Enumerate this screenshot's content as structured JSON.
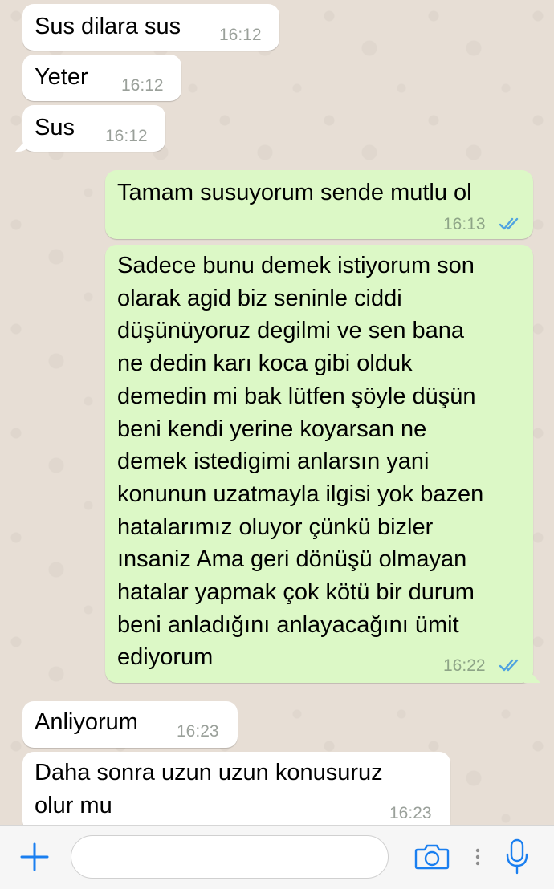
{
  "messages": [
    {
      "direction": "in",
      "lines": [
        "Sus dilara sus"
      ],
      "time": "16:12"
    },
    {
      "direction": "in",
      "lines": [
        "Yeter"
      ],
      "time": "16:12"
    },
    {
      "direction": "in",
      "lines": [
        "Sus"
      ],
      "time": "16:12"
    },
    {
      "direction": "out",
      "lines": [
        "Tamam susuyorum sende mutlu ol"
      ],
      "time": "16:13",
      "read": true
    },
    {
      "direction": "out",
      "lines": [
        "Sadece bunu demek istiyorum son",
        "olarak agid biz seninle ciddi",
        "düşünüyoruz degilmi ve sen bana",
        "ne dedin karı koca gibi olduk",
        "demedin mi bak lütfen şöyle düşün",
        "beni kendi yerine koyarsan ne",
        "demek istedigimi anlarsın yani",
        "konunun uzatmayla ilgisi yok bazen",
        "hatalarımız oluyor çünkü bizler",
        "ınsaniz Ama geri dönüşü olmayan",
        "hatalar yapmak çok kötü bir durum",
        "beni anladığını anlayacağını ümit",
        "ediyorum"
      ],
      "time": "16:22",
      "read": true
    },
    {
      "direction": "in",
      "lines": [
        "Anliyorum"
      ],
      "time": "16:23"
    },
    {
      "direction": "in",
      "lines": [
        "Daha sonra uzun uzun konusuruz",
        "olur mu"
      ],
      "time": "16:23"
    }
  ],
  "composer": {
    "input_value": "",
    "icons": [
      "plus-icon",
      "camera-icon",
      "microphone-icon"
    ],
    "accent_color": "#1a7ff0"
  },
  "colors": {
    "incoming_bubble": "#ffffff",
    "outgoing_bubble": "#dcf8c6",
    "read_ticks": "#4fa3e0"
  }
}
